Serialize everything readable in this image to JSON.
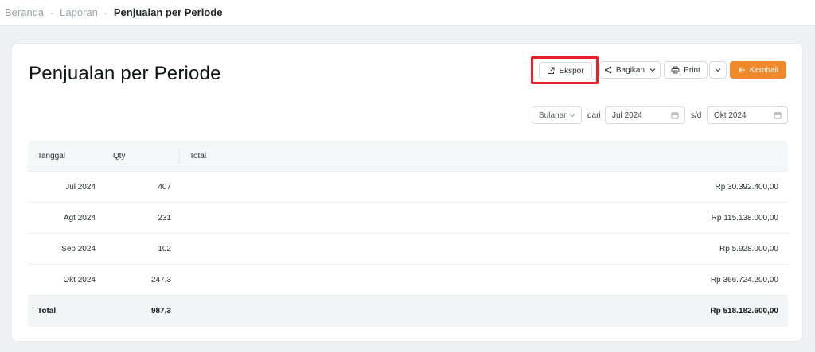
{
  "breadcrumb": {
    "items": [
      "Beranda",
      "Laporan"
    ],
    "separator": "-",
    "current": "Penjualan per Periode"
  },
  "page": {
    "title": "Penjualan per Periode"
  },
  "toolbar": {
    "export_label": "Ekspor",
    "share_label": "Bagikan",
    "print_label": "Print",
    "back_label": "Kembali",
    "icons": {
      "export": "external-link-icon",
      "share": "share-icon",
      "print": "printer-icon",
      "back": "arrow-left-icon",
      "dropdown": "chevron-down-icon"
    }
  },
  "filters": {
    "period_value": "Bulanan",
    "from_label": "dari",
    "from_value": "Jul 2024",
    "to_label": "s/d",
    "to_value": "Okt 2024",
    "icons": {
      "date": "calendar-icon",
      "dropdown": "chevron-down-icon"
    }
  },
  "table": {
    "columns": [
      "Tanggal",
      "Qty",
      "Total"
    ],
    "rows": [
      {
        "date": "Jul 2024",
        "qty": "407",
        "total": "Rp 30.392.400,00"
      },
      {
        "date": "Agt 2024",
        "qty": "231",
        "total": "Rp 115.138.000,00"
      },
      {
        "date": "Sep 2024",
        "qty": "102",
        "total": "Rp 5.928.000,00"
      },
      {
        "date": "Okt 2024",
        "qty": "247,3",
        "total": "Rp 366.724.200,00"
      }
    ],
    "footer": {
      "label": "Total",
      "qty": "987,3",
      "total": "Rp 518.182.600,00"
    }
  },
  "colors": {
    "accent": "#f0892a",
    "highlight": "#e8202a",
    "background": "#eef0f3",
    "card": "#ffffff"
  }
}
